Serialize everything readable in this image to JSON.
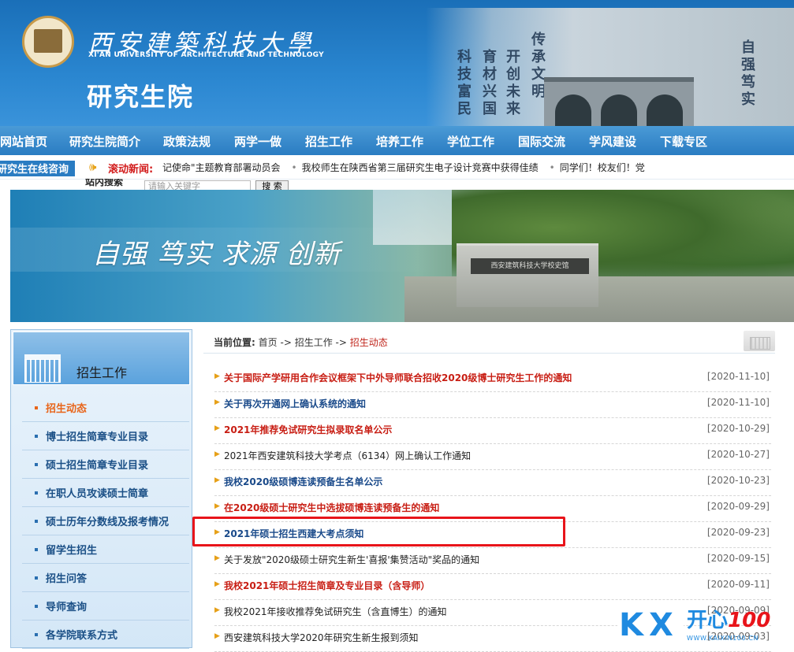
{
  "header": {
    "university_cn": "西安建築科技大學",
    "university_en": "XI'AN UNIVERSITY OF ARCHITECTURE AND TECHNOLOGY",
    "section_title": "研究生院",
    "calligraphy": [
      "自",
      "强",
      "笃",
      "实",
      "传",
      "承",
      "文",
      "明",
      "开",
      "创",
      "未",
      "来",
      "育",
      "材",
      "兴",
      "国",
      "科",
      "技",
      "富",
      "民"
    ]
  },
  "nav": {
    "items": [
      "网站首页",
      "研究生院简介",
      "政策法规",
      "两学一做",
      "招生工作",
      "培养工作",
      "学位工作",
      "国际交流",
      "学风建设",
      "下载专区"
    ]
  },
  "ticker": {
    "left_label": "研究生在线咨询",
    "scroll_label": "滚动新闻:",
    "items": [
      "记使命\"主题教育部署动员会",
      "我校师生在陕西省第三届研究生电子设计竞赛中获得佳绩",
      "同学们！校友们！党"
    ]
  },
  "search": {
    "label": "站内搜索",
    "placeholder": "请输入关键字",
    "button": "搜 索"
  },
  "banner": {
    "motto": "自强  笃实  求源  创新",
    "plaque": "西安建筑科技大学校史馆"
  },
  "sidebar": {
    "title": "招生工作",
    "items": [
      {
        "label": "招生动态",
        "active": true
      },
      {
        "label": "博士招生简章专业目录",
        "active": false
      },
      {
        "label": "硕士招生简章专业目录",
        "active": false
      },
      {
        "label": "在职人员攻读硕士简章",
        "active": false
      },
      {
        "label": "硕士历年分数线及报考情况",
        "active": false
      },
      {
        "label": "留学生招生",
        "active": false
      },
      {
        "label": "招生问答",
        "active": false
      },
      {
        "label": "导师查询",
        "active": false
      },
      {
        "label": "各学院联系方式",
        "active": false
      }
    ]
  },
  "breadcrumb": {
    "label": "当前位置:",
    "home": "首页",
    "sep": "->",
    "section": "招生工作",
    "current": "招生动态"
  },
  "news": [
    {
      "title": "关于国际产学研用合作会议框架下中外导师联合招收2020级博士研究生工作的通知",
      "date": "[2020-11-10]",
      "style": "red"
    },
    {
      "title": "关于再次开通网上确认系统的通知",
      "date": "[2020-11-10]",
      "style": "blue"
    },
    {
      "title": "2021年推荐免试研究生拟录取名单公示",
      "date": "[2020-10-29]",
      "style": "red"
    },
    {
      "title": "2021年西安建筑科技大学考点（6134）网上确认工作通知",
      "date": "[2020-10-27]",
      "style": "black"
    },
    {
      "title": "我校2020级硕博连读预备生名单公示",
      "date": "[2020-10-23]",
      "style": "blue"
    },
    {
      "title": "在2020级硕士研究生中选拔硕博连读预备生的通知",
      "date": "[2020-09-29]",
      "style": "red"
    },
    {
      "title": "2021年硕士招生西建大考点须知",
      "date": "[2020-09-23]",
      "style": "blue"
    },
    {
      "title": "关于发放\"2020级硕士研究生新生'喜报'集赞活动\"奖品的通知",
      "date": "[2020-09-15]",
      "style": "black"
    },
    {
      "title": "我校2021年硕士招生简章及专业目录（含导师）",
      "date": "[2020-09-11]",
      "style": "red"
    },
    {
      "title": "我校2021年接收推荐免试研究生（含直博生）的通知",
      "date": "[2020-09-09]",
      "style": "black"
    },
    {
      "title": "西安建筑科技大学2020年研究生新生报到须知",
      "date": "[2020-09-03]",
      "style": "black"
    }
  ],
  "watermark": {
    "brand_text": "开心",
    "brand_num": "100",
    "url": "WWW.KAIXIN100.CN"
  },
  "colors": {
    "header_blue": "#1a6fb8",
    "nav_blue": "#2a7cc2",
    "accent_red": "#c81e14",
    "accent_orange": "#e8651a",
    "link_blue": "#1a4a8a",
    "highlight_red": "#e8141a"
  }
}
